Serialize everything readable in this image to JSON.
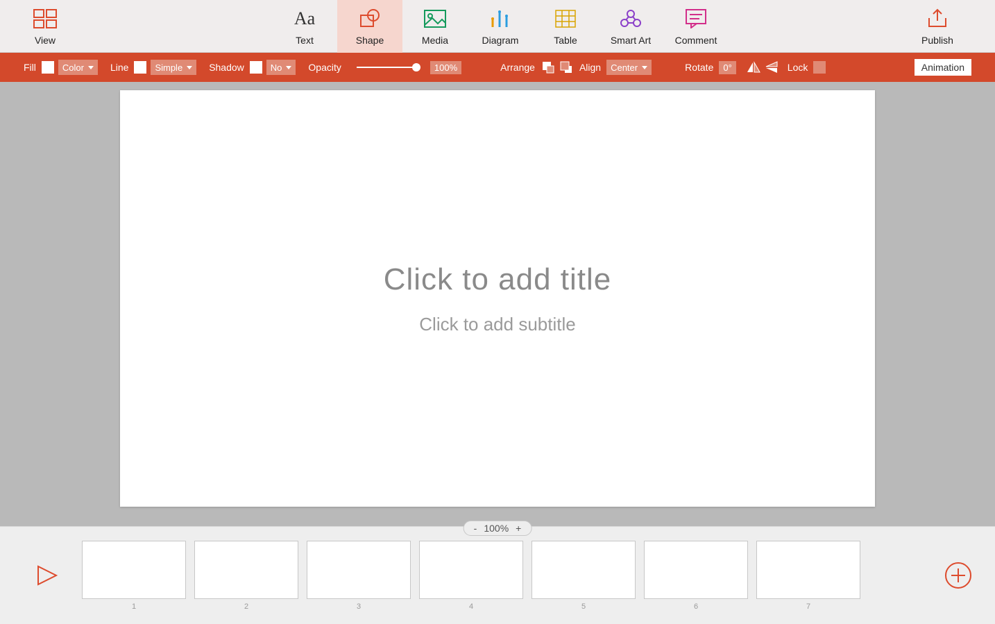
{
  "toolbar": {
    "view": "View",
    "text": "Text",
    "shape": "Shape",
    "media": "Media",
    "diagram": "Diagram",
    "table": "Table",
    "smartart": "Smart Art",
    "comment": "Comment",
    "publish": "Publish",
    "active": "shape"
  },
  "prop": {
    "fill_label": "Fill",
    "fill_value": "Color",
    "line_label": "Line",
    "line_value": "Simple",
    "shadow_label": "Shadow",
    "shadow_value": "No",
    "opacity_label": "Opacity",
    "opacity_value": "100%",
    "arrange_label": "Arrange",
    "align_label": "Align",
    "align_value": "Center",
    "rotate_label": "Rotate",
    "rotate_value": "0°",
    "lock_label": "Lock",
    "animation_label": "Animation"
  },
  "slide": {
    "title_placeholder": "Click to add title",
    "subtitle_placeholder": "Click to add subtitle"
  },
  "zoom": {
    "minus": "-",
    "value": "100%",
    "plus": "+"
  },
  "thumbs": [
    "1",
    "2",
    "3",
    "4",
    "5",
    "6",
    "7"
  ],
  "colors": {
    "accent": "#dd4b2d",
    "accent_light": "#e08a75"
  }
}
